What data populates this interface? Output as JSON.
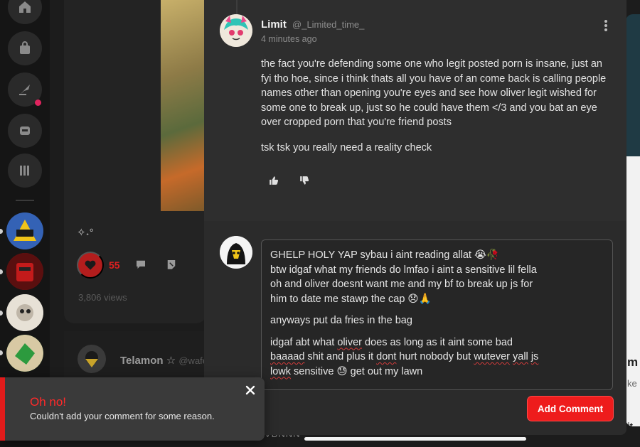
{
  "background_post": {
    "like_count": "55",
    "views": "3,806 views",
    "sparkle": "✧˖°"
  },
  "background_comment": {
    "author": "Telamon ☆",
    "handle": "@wafe"
  },
  "bottom_peek_text": "VBNNN",
  "right_peek": {
    "line1": "m",
    "line2": "ke",
    "line3": "it S"
  },
  "comment": {
    "author": "Limit",
    "handle": "@_Limited_time_",
    "time": "4 minutes ago",
    "paragraphs": [
      "the fact you're defending some one who legit posted porn is insane, just an fyi tho hoe, since i think thats all you have of an come back is calling people names other than opening you're eyes and see how oliver legit wished for some one to break up, just so he could have them </3 and you bat an eye over cropped porn that you're friend posts",
      "tsk tsk you really need a reality check"
    ]
  },
  "reply_draft": {
    "p1_line1": "GHELP HOLY YAP sybau i aint reading allat 😭🥀",
    "p1_line2": "btw idgaf what my friends do lmfao i aint a sensitive lil fella",
    "p1_line3": "oh and oliver doesnt want me and my bf to break up js for",
    "p1_line4": "him to date me stawp the cap 😞🙏",
    "p2": "anyways put da fries in the bag",
    "p3_a": "idgaf abt what ",
    "p3_b": "oliver",
    "p3_c": " does as long as it aint some bad",
    "p3_d": "baaaad",
    "p3_e": " shit and plus it ",
    "p3_f": "dont",
    "p3_g": " hurt nobody but ",
    "p3_h": "wutever",
    "p3_i": " ",
    "p3_j": "yall",
    "p3_k": " ",
    "p3_l": "js",
    "p3_m": "lowk",
    "p3_n": " sensitive 😓 get out my lawn"
  },
  "add_comment_label": "Add Comment",
  "toast": {
    "title": "Oh no!",
    "message": "Couldn't add your comment for some reason."
  },
  "colors": {
    "accent_red": "#ee1c1c",
    "panel": "#2b2b2b"
  }
}
